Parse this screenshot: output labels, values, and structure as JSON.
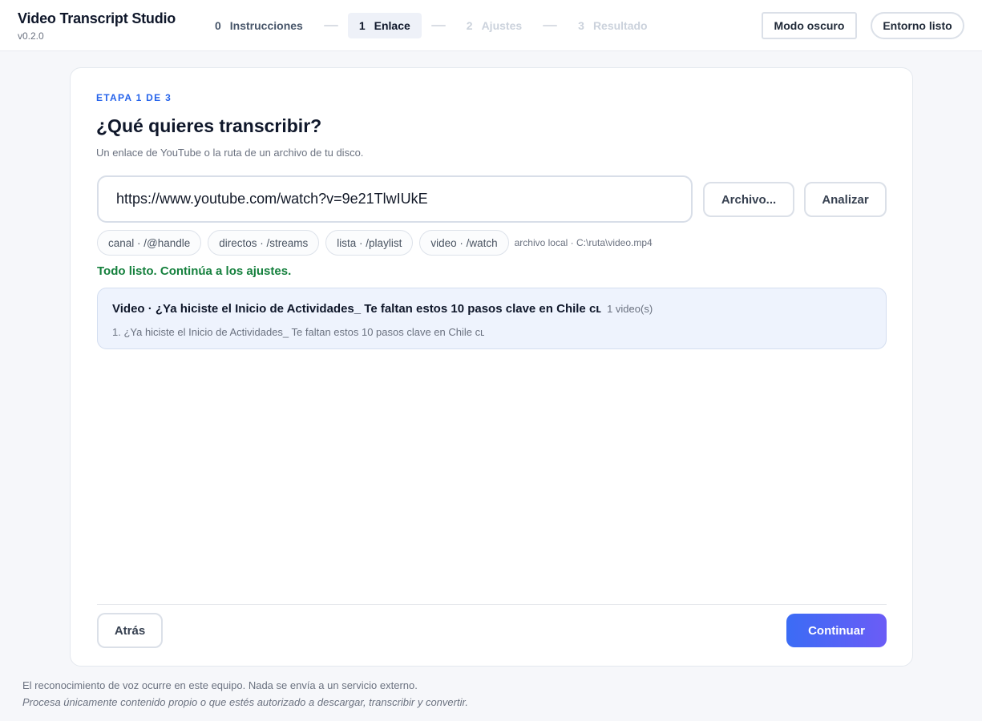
{
  "app": {
    "title": "Video Transcript Studio",
    "version": "v0.2.0"
  },
  "steps": [
    {
      "num": "0",
      "label": "Instrucciones",
      "state": "done"
    },
    {
      "num": "1",
      "label": "Enlace",
      "state": "active"
    },
    {
      "num": "2",
      "label": "Ajustes",
      "state": "upcoming"
    },
    {
      "num": "3",
      "label": "Resultado",
      "state": "upcoming"
    }
  ],
  "header": {
    "dark_mode_label": "Modo oscuro",
    "env_status_label": "Entorno listo"
  },
  "card": {
    "eyebrow": "ETAPA 1 DE 3",
    "title": "¿Qué quieres transcribir?",
    "subtitle": "Un enlace de YouTube o la ruta de un archivo de tu disco.",
    "url_value": "https://www.youtube.com/watch?v=9e21TlwIUkE",
    "file_button": "Archivo...",
    "analyze_button": "Analizar",
    "chips": [
      "canal · /@handle",
      "directos · /streams",
      "lista · /playlist",
      "video · /watch"
    ],
    "local_note": "archivo local · C:\\ruta\\video.mp4",
    "status": "Todo listo. Continúa a los ajustes.",
    "result": {
      "title": "Video · ¿Ya hiciste el Inicio de Actividades_ Te faltan estos 10 pasos clave en Chile ᴄʟ",
      "count": "1 video(s)",
      "items": [
        "1. ¿Ya hiciste el Inicio de Actividades_ Te faltan estos 10 pasos clave en Chile ᴄʟ"
      ]
    },
    "back_button": "Atrás",
    "continue_button": "Continuar"
  },
  "footer": {
    "line1": "El reconocimiento de voz ocurre en este equipo. Nada se envía a un servicio externo.",
    "line2": "Procesa únicamente contenido propio o que estés autorizado a descargar, transcribir y convertir."
  },
  "colors": {
    "accent": "#2563eb",
    "success": "#15803d",
    "gradient_start": "#3b6cf5",
    "gradient_end": "#6b5cf6"
  }
}
